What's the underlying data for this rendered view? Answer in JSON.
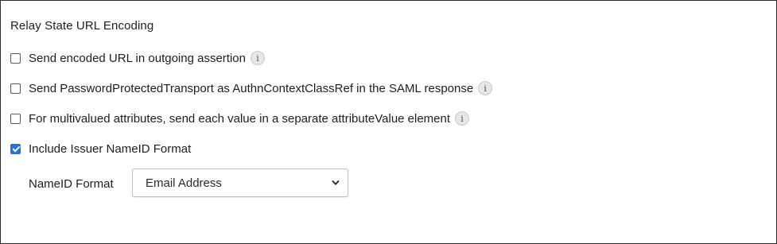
{
  "section": {
    "title": "Relay State URL Encoding"
  },
  "options": [
    {
      "label": "Send encoded URL in outgoing assertion",
      "checked": false,
      "info_glyph": "i"
    },
    {
      "label": "Send PasswordProtectedTransport as AuthnContextClassRef in the SAML response",
      "checked": false,
      "info_glyph": "i"
    },
    {
      "label": "For multivalued attributes, send each value in a separate attributeValue element",
      "checked": false,
      "info_glyph": "i"
    },
    {
      "label": "Include Issuer NameID Format",
      "checked": true
    }
  ],
  "nameid_format": {
    "label": "NameID Format",
    "selected": "Email Address"
  },
  "colors": {
    "checkbox_checked": "#1a73e8",
    "border": "#2b2b2b"
  }
}
